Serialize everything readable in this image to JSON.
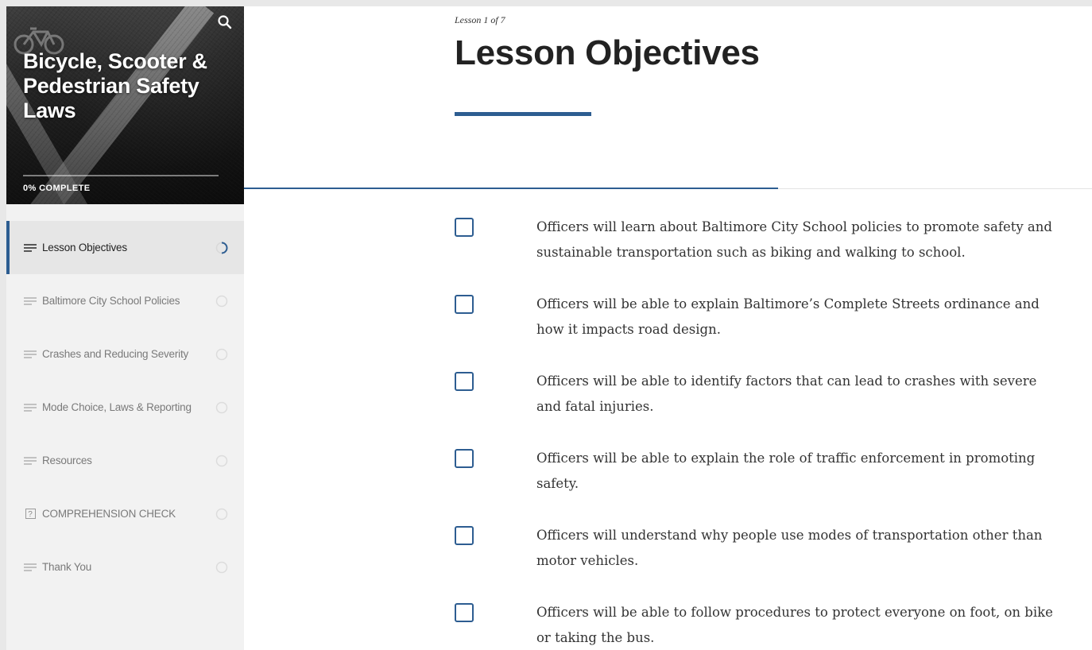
{
  "sidebar": {
    "course_title": "Bicycle, Scooter & Pedestrian Safety Laws",
    "progress_label": "0% COMPLETE",
    "progress_fraction": 0,
    "search_icon": "search-icon",
    "items": [
      {
        "label": "Lesson Objectives",
        "icon": "lesson-lines-icon",
        "status": "in-progress",
        "active": true
      },
      {
        "label": "Baltimore City School Policies",
        "icon": "lesson-lines-icon",
        "status": "not-started",
        "active": false
      },
      {
        "label": "Crashes and Reducing Severity",
        "icon": "lesson-lines-icon",
        "status": "not-started",
        "active": false
      },
      {
        "label": "Mode Choice, Laws & Reporting",
        "icon": "lesson-lines-icon",
        "status": "not-started",
        "active": false
      },
      {
        "label": "Resources",
        "icon": "lesson-lines-icon",
        "status": "not-started",
        "active": false
      },
      {
        "label": "COMPREHENSION CHECK",
        "icon": "quiz-icon",
        "quiz_glyph": "?",
        "status": "not-started",
        "active": false
      },
      {
        "label": "Thank You",
        "icon": "lesson-lines-icon",
        "status": "not-started",
        "active": false
      }
    ]
  },
  "main": {
    "lesson_count": "Lesson 1 of 7",
    "lesson_title": "Lesson Objectives",
    "lesson_progress_fraction": 0.63,
    "objectives": [
      {
        "line1": "Officers will learn about Baltimore City School policies to promote safety and",
        "line2": "sustainable transportation such as biking and walking to school.",
        "checked": false
      },
      {
        "line1": "Officers will be able to explain Baltimore’s Complete Streets ordinance and",
        "line2": "how it impacts road design.",
        "checked": false
      },
      {
        "line1": "Officers will be able to identify factors that can lead to crashes with severe",
        "line2": "and fatal injuries.",
        "checked": false
      },
      {
        "line1": "Officers will be able to explain the role of traffic enforcement in promoting",
        "line2": "safety.",
        "checked": false
      },
      {
        "line1": "Officers will understand why people use modes of transportation other than",
        "line2": "motor vehicles.",
        "checked": false
      },
      {
        "line1": "Officers will be able to follow procedures to protect everyone on foot, on bike",
        "line2": "or taking the bus.",
        "checked": false
      }
    ]
  },
  "colors": {
    "accent": "#2d5d91",
    "sidebar_bg": "#f2f2f2",
    "active_item_bg": "#e6e6e6"
  }
}
